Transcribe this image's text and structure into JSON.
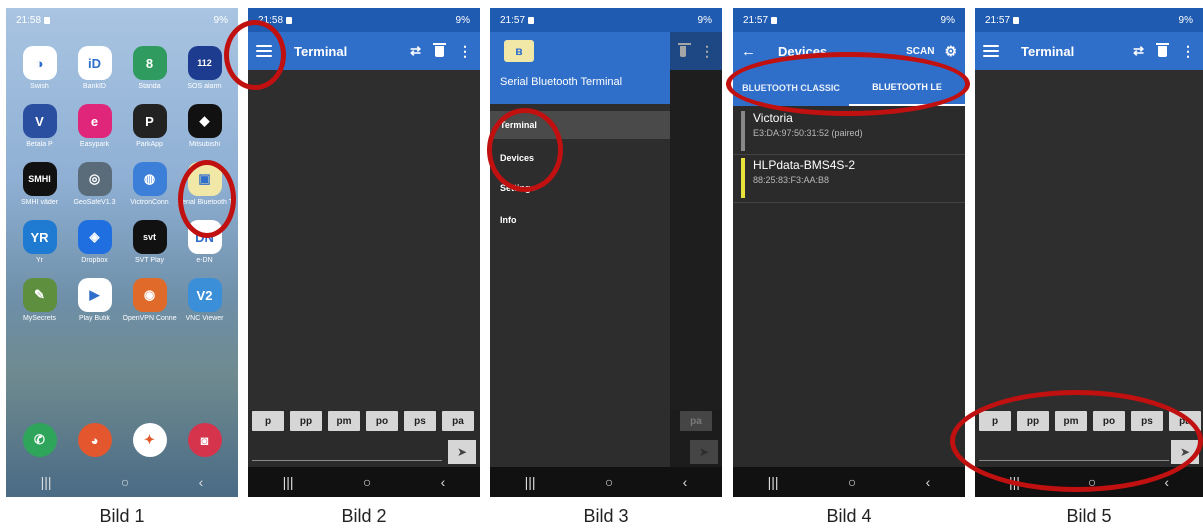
{
  "captions": [
    "Bild 1",
    "Bild 2",
    "Bild 3",
    "Bild 4",
    "Bild 5"
  ],
  "phone1": {
    "time": "21:58",
    "battery": "9%",
    "apps": [
      {
        "label": "Swish",
        "glyph": "◑",
        "color": "#ffffff"
      },
      {
        "label": "BankID",
        "glyph": "iD",
        "color": "#ffffff"
      },
      {
        "label": "Standa",
        "glyph": "8",
        "color": "#2f9b5e"
      },
      {
        "label": "SOS alarm",
        "glyph": "112",
        "color": "#1d3b8f"
      },
      {
        "label": "Betala P",
        "glyph": "V",
        "color": "#2a4fa0"
      },
      {
        "label": "Easypark",
        "glyph": "e",
        "color": "#e0267a"
      },
      {
        "label": "ParkApp",
        "glyph": "P",
        "color": "#222222"
      },
      {
        "label": "Mitsubishi",
        "glyph": "◆",
        "color": "#111111"
      },
      {
        "label": "SMHI väder",
        "glyph": "SMHI",
        "color": "#111111"
      },
      {
        "label": "GeoSafeV1.3",
        "glyph": "◎",
        "color": "#5a6b7a"
      },
      {
        "label": "VictronConn",
        "glyph": "◍",
        "color": "#3b7fd8"
      },
      {
        "label": "Serial Bluetooth Te",
        "glyph": "▣",
        "color": "#f1e8a8"
      },
      {
        "label": "Yr",
        "glyph": "YR",
        "color": "#1f7ad1"
      },
      {
        "label": "Dropbox",
        "glyph": "◈",
        "color": "#1f6fe0"
      },
      {
        "label": "SVT Play",
        "glyph": "svt",
        "color": "#111111"
      },
      {
        "label": "e-DN",
        "glyph": "DN",
        "color": "#ffffff"
      },
      {
        "label": "MySecrets",
        "glyph": "✎",
        "color": "#5d8f3f"
      },
      {
        "label": "Play Butik",
        "glyph": "▶",
        "color": "#ffffff"
      },
      {
        "label": "OpenVPN Connect",
        "glyph": "◉",
        "color": "#e06a2a"
      },
      {
        "label": "VNC Viewer",
        "glyph": "V2",
        "color": "#3b8fd8"
      }
    ],
    "dock": [
      {
        "glyph": "✆",
        "color": "#2ea55a"
      },
      {
        "glyph": "◕",
        "color": "#e4572e"
      },
      {
        "glyph": "✦",
        "color": "#ffffff"
      },
      {
        "glyph": "◙",
        "color": "#d6334c"
      }
    ]
  },
  "terminal": {
    "time": "21:58",
    "time5": "21:57",
    "battery": "9%",
    "title": "Terminal",
    "macros": [
      "p",
      "pp",
      "pm",
      "po",
      "ps",
      "pa"
    ]
  },
  "drawer": {
    "time": "21:57",
    "battery": "9%",
    "app_name": "Serial Bluetooth Terminal",
    "items": [
      "Terminal",
      "Devices",
      "Settings",
      "Info"
    ]
  },
  "devices": {
    "time": "21:57",
    "battery": "9%",
    "title": "Devices",
    "scan": "SCAN",
    "tabs": [
      "BLUETOOTH CLASSIC",
      "BLUETOOTH LE"
    ],
    "list": [
      {
        "name": "Victoria",
        "address": "E3:DA:97:50:31:52 (paired)",
        "color": "#888888"
      },
      {
        "name": "HLPdata-BMS4S-2",
        "address": "88:25:83:F3:AA:B8",
        "color": "#e8e23a"
      }
    ]
  }
}
